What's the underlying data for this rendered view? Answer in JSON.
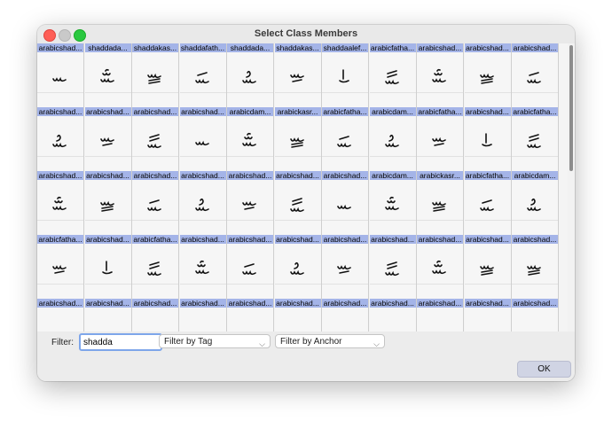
{
  "window": {
    "title": "Select Class Members"
  },
  "grid": {
    "rows": [
      {
        "labels": [
          "arabicshad...",
          "shaddada...",
          "shaddakas...",
          "shaddafath...",
          "shaddada...",
          "shaddakas...",
          "shaddaalef...",
          "arabicfatha...",
          "arabicshad...",
          "arabicshad...",
          "arabicshad..."
        ],
        "glyphs": [
          "s",
          "dd",
          "kk",
          "ff",
          "dw",
          "ks",
          "al",
          "ff2",
          "dd",
          "kk",
          "ff"
        ]
      },
      {
        "labels": [
          "arabicshad...",
          "arabicshad...",
          "arabicshad...",
          "arabicshad...",
          "arabicdam...",
          "arabickasr...",
          "arabicfatha...",
          "arabicdam...",
          "arabicfatha...",
          "arabicshad...",
          "arabicfatha..."
        ],
        "glyphs": [
          "dw",
          "ks",
          "ff2",
          "s",
          "dd",
          "kk",
          "ff",
          "dw",
          "ks",
          "al",
          "ff2"
        ]
      },
      {
        "labels": [
          "arabicshad...",
          "arabicshad...",
          "arabicshad...",
          "arabicshad...",
          "arabicshad...",
          "arabicshad...",
          "arabicshad...",
          "arabicdam...",
          "arabickasr...",
          "arabicfatha...",
          "arabicdam..."
        ],
        "glyphs": [
          "dd",
          "kk",
          "ff",
          "dw",
          "ks",
          "ff2",
          "s",
          "dd",
          "kk",
          "ff",
          "dw"
        ]
      },
      {
        "labels": [
          "arabicfatha...",
          "arabicshad...",
          "arabicfatha...",
          "arabicshad...",
          "arabicshad...",
          "arabicshad...",
          "arabicshad...",
          "arabicshad...",
          "arabicshad...",
          "arabicshad...",
          "arabicshad..."
        ],
        "glyphs": [
          "ks",
          "al",
          "ff2",
          "dd",
          "ff",
          "dw",
          "ks",
          "ff2",
          "dd",
          "kk",
          "kk"
        ]
      },
      {
        "labels": [
          "arabicshad...",
          "arabicshad...",
          "arabicshad...",
          "arabicshad...",
          "arabicshad...",
          "arabicshad...",
          "arabicshad...",
          "arabicshad...",
          "arabicshad...",
          "arabicshad...",
          "arabicshad..."
        ],
        "glyphs": [
          "s",
          "s",
          "s",
          "s",
          "s",
          "s",
          "s",
          "s",
          "s",
          "s",
          "s"
        ]
      }
    ]
  },
  "filter": {
    "label": "Filter:",
    "value": "shadda",
    "tag_select": "Filter by Tag",
    "anchor_select": "Filter by Anchor"
  },
  "ok_label": "OK"
}
